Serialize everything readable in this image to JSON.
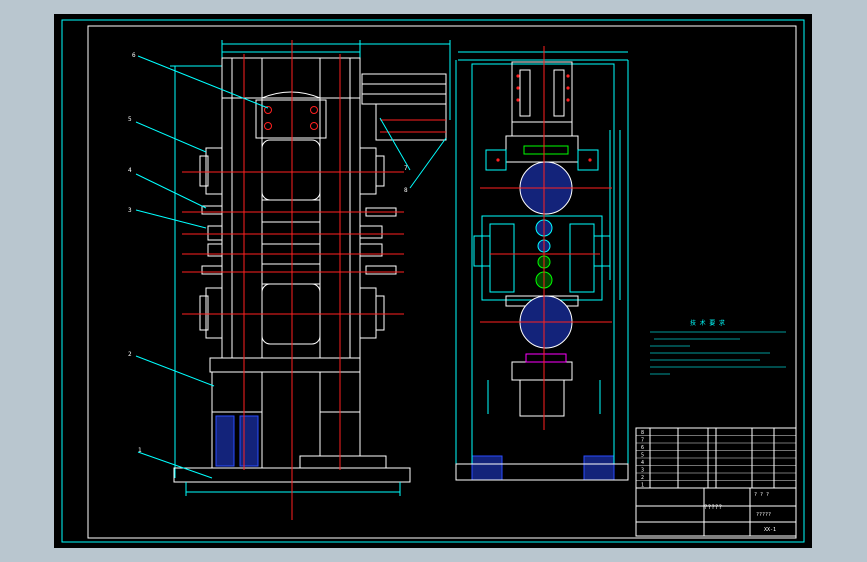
{
  "colors": {
    "window_bg": "#b9c6cf",
    "drawing_bg": "#000000",
    "line_white": "#ffffff",
    "line_cyan": "#00ffff",
    "line_red": "#ff2020",
    "line_blue": "#2a4cff",
    "line_green": "#00ff00",
    "line_magenta": "#ff00ff",
    "line_yellow": "#ffff00"
  },
  "left_view": {
    "part_labels": [
      "6",
      "5",
      "4",
      "3",
      "2",
      "1"
    ],
    "side_labels": [
      "7",
      "8"
    ]
  },
  "notes": {
    "title": "技 术 要 求"
  },
  "title_block": {
    "drawing_name": "?????",
    "company": "?????",
    "drawing_no": "XX-1",
    "scale": "? ? ?",
    "bom_rows": [
      {
        "no": "8",
        "code": "",
        "name": "",
        "qty": "",
        "material": "",
        "weight": ""
      },
      {
        "no": "7",
        "code": "",
        "name": "",
        "qty": "",
        "material": "",
        "weight": ""
      },
      {
        "no": "6",
        "code": "",
        "name": "",
        "qty": "",
        "material": "",
        "weight": ""
      },
      {
        "no": "5",
        "code": "",
        "name": "",
        "qty": "",
        "material": "",
        "weight": ""
      },
      {
        "no": "4",
        "code": "",
        "name": "",
        "qty": "",
        "material": "",
        "weight": ""
      },
      {
        "no": "3",
        "code": "",
        "name": "",
        "qty": "",
        "material": "",
        "weight": ""
      },
      {
        "no": "2",
        "code": "",
        "name": "",
        "qty": "",
        "material": "",
        "weight": ""
      },
      {
        "no": "1",
        "code": "",
        "name": "",
        "qty": "",
        "material": "",
        "weight": ""
      }
    ]
  }
}
